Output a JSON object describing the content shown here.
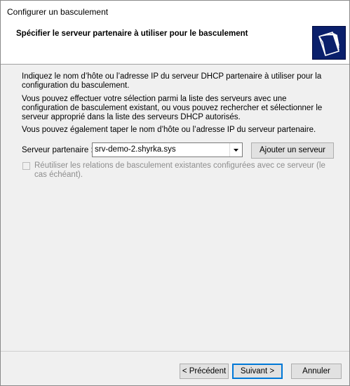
{
  "window": {
    "title": "Configurer un basculement"
  },
  "header": {
    "title": "Spécifier le serveur partenaire à utiliser pour le basculement",
    "icon": "folders-icon",
    "icon_bg": "#0a1f6b"
  },
  "body": {
    "p1": "Indiquez le nom d’hôte ou l’adresse IP du serveur DHCP partenaire à utiliser pour la configuration du basculement.",
    "p2": "Vous pouvez effectuer votre sélection parmi la liste des serveurs avec une configuration de basculement existant, ou vous pouvez rechercher et sélectionner le serveur approprié dans la liste des serveurs DHCP autorisés.",
    "p3": "Vous pouvez également taper le nom d’hôte ou l’adresse IP du serveur partenaire.",
    "partner_label": "Serveur partenaire :",
    "partner_value": "srv-demo-2.shyrka.sys",
    "add_server_button": "Ajouter un serveur",
    "reuse_checkbox_label": "Réutiliser les relations de basculement existantes configurées avec ce serveur (le cas échéant).",
    "reuse_checked": false,
    "reuse_disabled": true
  },
  "footer": {
    "prev_button": "< Précédent",
    "next_button": "Suivant >",
    "cancel_button": "Annuler"
  }
}
